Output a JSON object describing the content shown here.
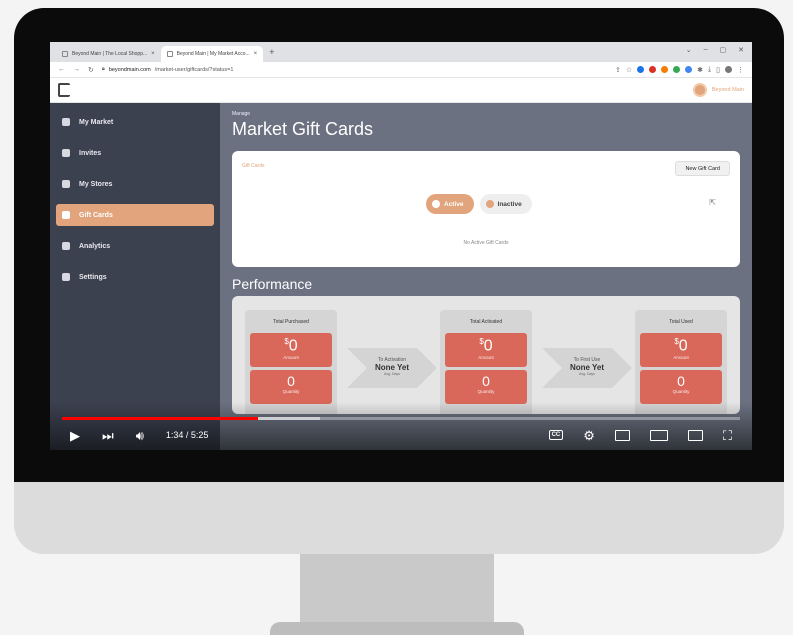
{
  "browser": {
    "tabs": [
      {
        "label": "Beyond Main | The Local Shopp...",
        "close": "×"
      },
      {
        "label": "Beyond Main | My Market Acco...",
        "close": "×"
      }
    ],
    "new_tab": "+",
    "url_host": "beyondmain.com",
    "url_path": "/market-user/giftcards/?status=1",
    "window_controls": [
      "⌄",
      "–",
      "▢",
      "✕"
    ]
  },
  "app": {
    "user_name": "Beyond Main",
    "sidebar": [
      {
        "label": "My Market",
        "icon": "home-icon"
      },
      {
        "label": "Invites",
        "icon": "invite-icon"
      },
      {
        "label": "My Stores",
        "icon": "store-icon"
      },
      {
        "label": "Gift Cards",
        "icon": "gift-card-icon",
        "active": true
      },
      {
        "label": "Analytics",
        "icon": "analytics-icon"
      },
      {
        "label": "Settings",
        "icon": "settings-icon"
      }
    ],
    "breadcrumb": "Manage",
    "page_title": "Market Gift Cards",
    "gift_cards": {
      "label": "Gift Cards",
      "new_button": "New Gift Card",
      "active_label": "Active",
      "inactive_label": "Inactive",
      "empty_text": "No Active Gift Cards"
    },
    "performance": {
      "title": "Performance",
      "columns": [
        {
          "header": "Total Purchased",
          "amount": "0",
          "amount_label": "Amount",
          "quantity": "0",
          "quantity_label": "Quantity"
        },
        {
          "header": "Total Activated",
          "amount": "0",
          "amount_label": "Amount",
          "quantity": "0",
          "quantity_label": "Quantity"
        },
        {
          "header": "Total Used",
          "amount": "0",
          "amount_label": "Amount",
          "quantity": "0",
          "quantity_label": "Quantity"
        }
      ],
      "arrows": [
        {
          "title": "To Activation",
          "value": "None Yet",
          "sub": "Avg. Days"
        },
        {
          "title": "To First Use",
          "value": "None Yet",
          "sub": "Avg. Days"
        }
      ],
      "currency": "$"
    },
    "colors": {
      "accent": "#e1a47c",
      "sidebar": "#3c4150",
      "main": "#6b7180",
      "stat": "#d9685a"
    }
  },
  "player": {
    "time": "1:34 / 5:25",
    "progress_fraction": 0.289,
    "buffered_fraction": 0.38,
    "cc_label": "CC"
  }
}
